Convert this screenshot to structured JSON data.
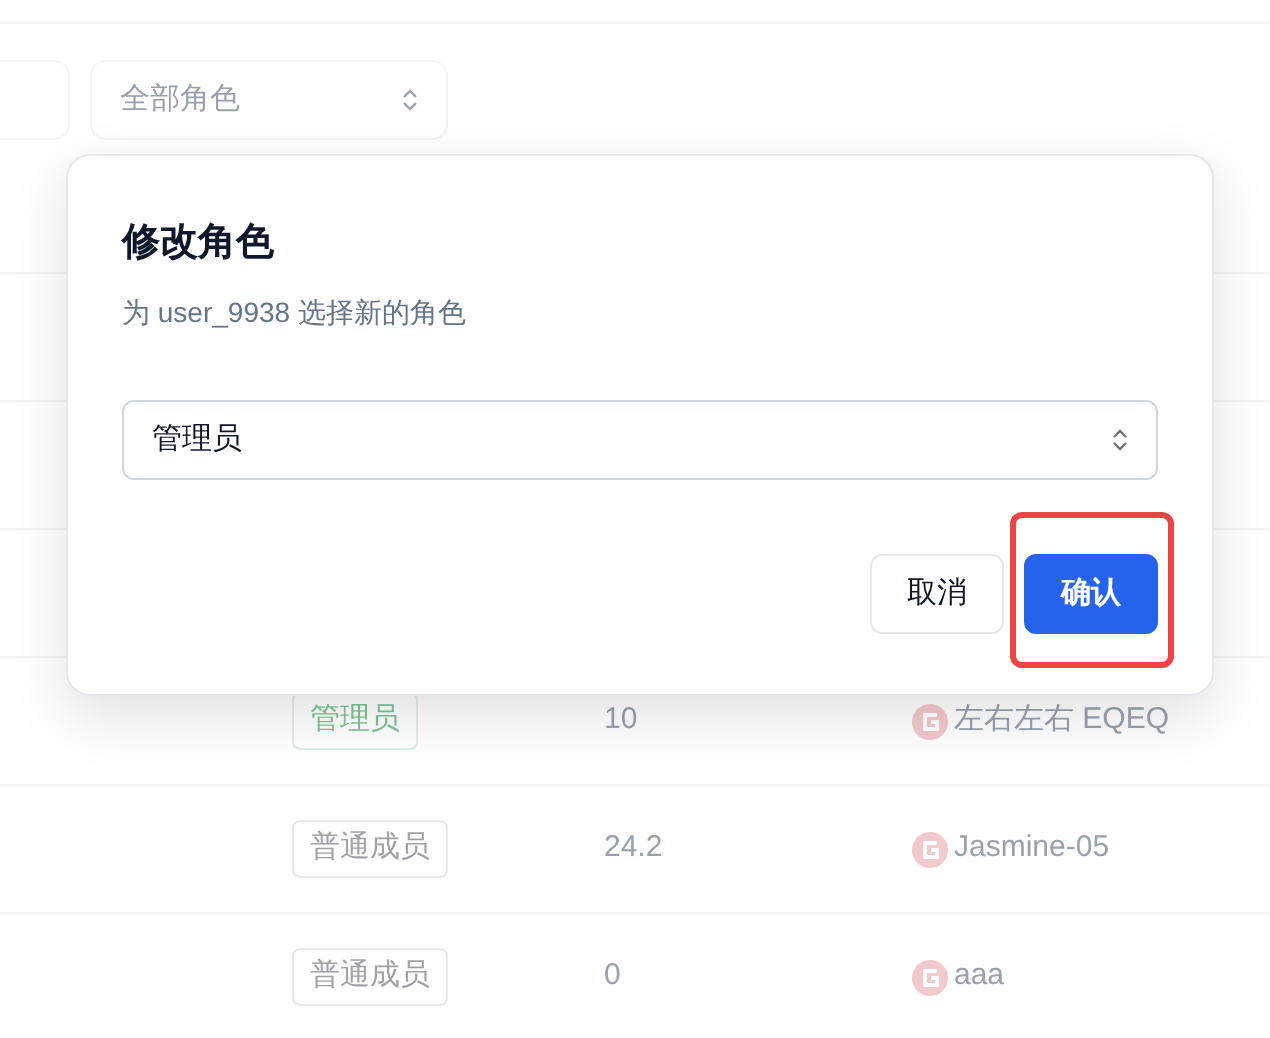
{
  "filters": {
    "role_select": {
      "placeholder": "全部角色"
    }
  },
  "members": [
    {
      "role": "管理员",
      "color": "#7cc495",
      "amount": "10",
      "name": "左右左右 EQEQ"
    },
    {
      "role": "普通成员",
      "color": "#a1a1aa",
      "amount": "24.2",
      "name": "Jasmine-05"
    },
    {
      "role": "普通成员",
      "color": "#a1a1aa",
      "amount": "0",
      "name": "aaa"
    }
  ],
  "dialog": {
    "title": "修改角色",
    "description": "为 user_9938 选择新的角色",
    "role_select": {
      "value": "管理员"
    },
    "buttons": [
      {
        "label": "取消",
        "kind": "secondary",
        "highlighted": false
      },
      {
        "label": "确认",
        "kind": "primary",
        "highlighted": true
      }
    ]
  }
}
